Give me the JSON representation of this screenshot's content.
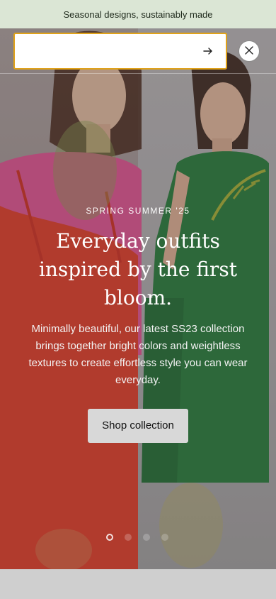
{
  "announcement": {
    "text": "Seasonal designs, sustainably made"
  },
  "search": {
    "value": "",
    "placeholder": "",
    "submit_icon": "arrow-right-icon",
    "close_icon": "close-icon",
    "focus_color": "#e0a21a"
  },
  "hero": {
    "eyebrow": "SPRING SUMMER '25",
    "headline": "Everyday outfits inspired by the first bloom.",
    "body": "Minimally beautiful, our latest SS23 collection brings together bright colors and weightless textures to create effortless style you can wear everyday.",
    "cta_label": "Shop collection",
    "slides_total": 4,
    "active_slide": 1
  },
  "colors": {
    "announcement_bg": "#dbe6d5",
    "dress_left": "#d8412f",
    "dress_right": "#2f7a3f",
    "top_left": "#d8558f"
  }
}
